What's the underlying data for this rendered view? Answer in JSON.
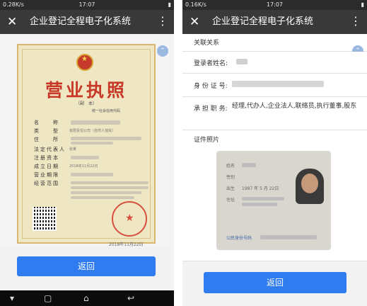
{
  "left_phone": {
    "status": {
      "left": "0.28K/s",
      "time": "17:07"
    },
    "title": "企业登记全程电子化系统",
    "license": {
      "title": "营业执照",
      "subtitle": "（副　本）",
      "code_label": "统一社会信用代码",
      "fields": [
        {
          "label": "名　　称",
          "value": ""
        },
        {
          "label": "类　　型",
          "value": "有限责任公司（自然人独资）"
        },
        {
          "label": "住　　所",
          "value": ""
        },
        {
          "label": "法定代表人",
          "value": "张某"
        },
        {
          "label": "注册资本",
          "value": ""
        },
        {
          "label": "成立日期",
          "value": "2018年11月22日"
        },
        {
          "label": "营业期限",
          "value": ""
        },
        {
          "label": "经营范围",
          "value": ""
        }
      ],
      "issue_date": "2018年11月22日"
    },
    "back_button": "返回"
  },
  "right_phone": {
    "status": {
      "left": "0.16K/s",
      "time": "17:07"
    },
    "title": "企业登记全程电子化系统",
    "section_title": "关联关系",
    "fields": [
      {
        "label": "登录者姓名:",
        "value": ""
      },
      {
        "label": "身 份 证 号:",
        "value": ""
      },
      {
        "label": "承 担 职 务:",
        "value": "经理,代办人,企业法人,联络员,执行董事,股东"
      },
      {
        "label": "证件照片",
        "value": ""
      }
    ],
    "idcard": {
      "name_label": "姓名",
      "sex_label": "性别",
      "born_label": "出生",
      "born_value": "1987 年 5 月 22日",
      "address_label": "住址",
      "id_label": "公民身份号码"
    },
    "back_button": "返回"
  }
}
